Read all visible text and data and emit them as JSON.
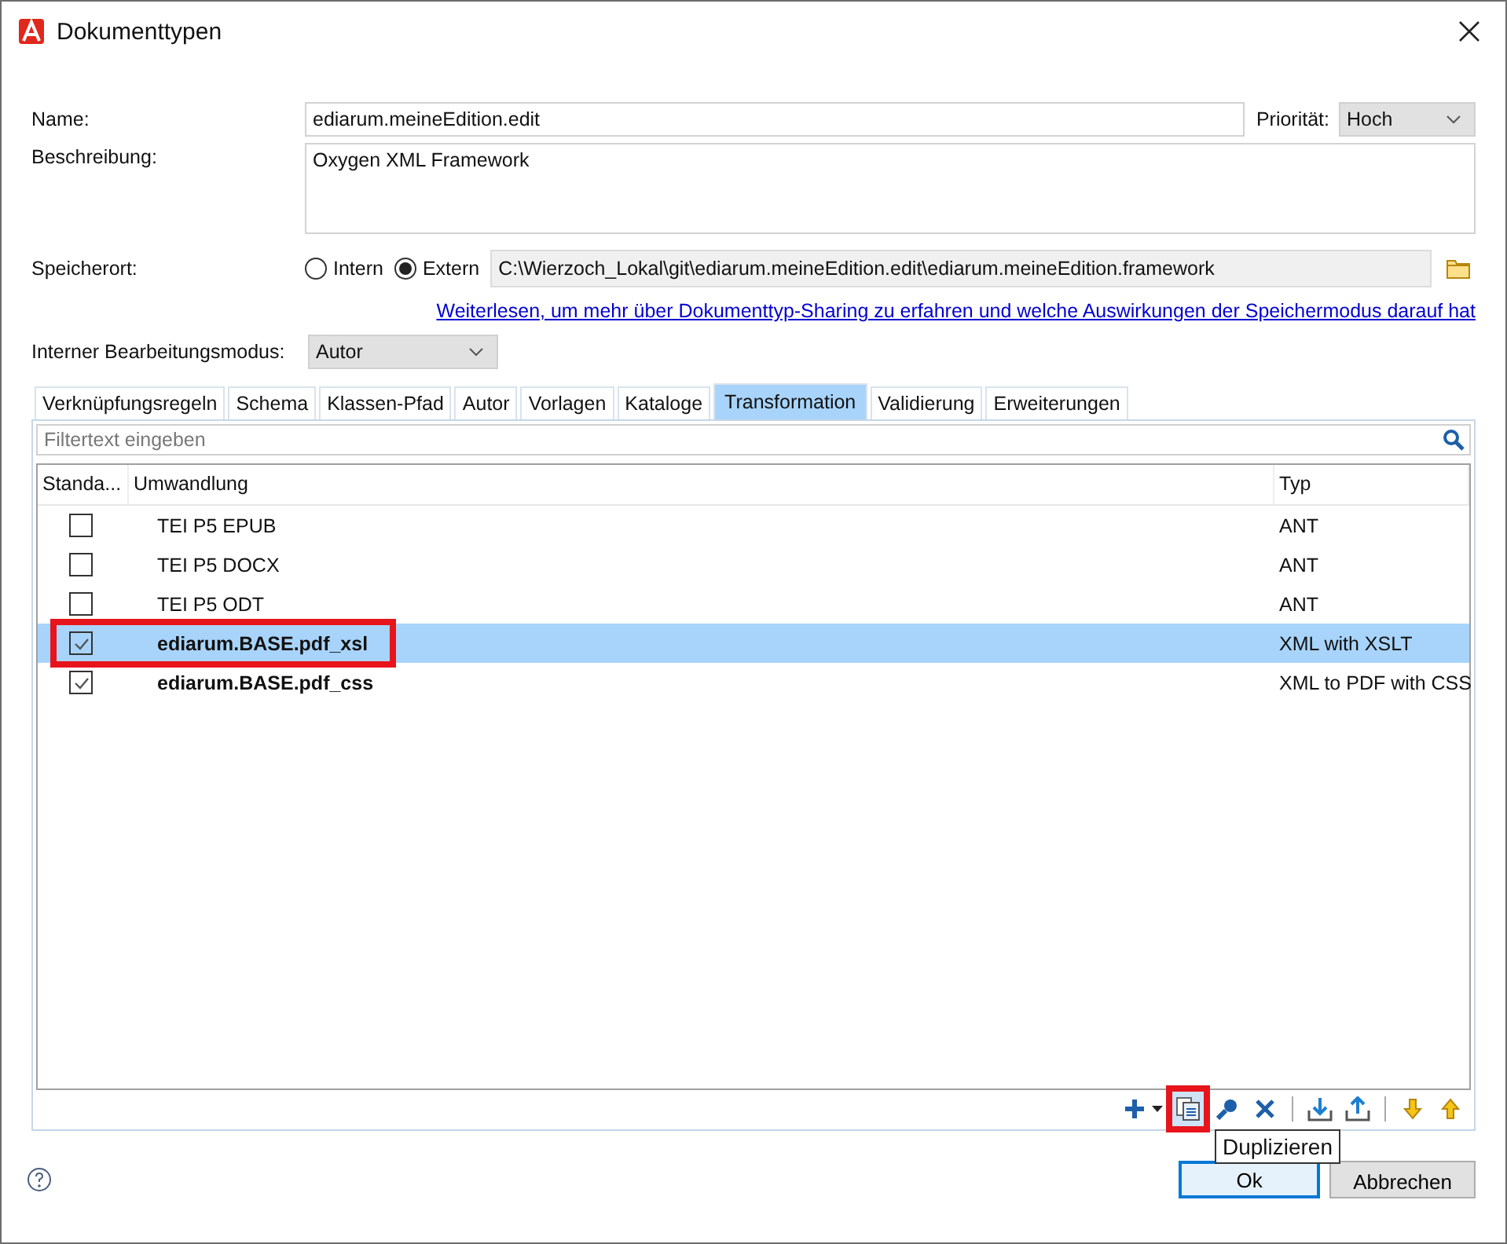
{
  "window": {
    "title": "Dokumenttypen"
  },
  "form": {
    "name_label": "Name:",
    "name_value": "ediarum.meineEdition.edit",
    "priority_label": "Priorität:",
    "priority_value": "Hoch",
    "description_label": "Beschreibung:",
    "description_value": "Oxygen XML Framework",
    "location_label": "Speicherort:",
    "location_options": [
      {
        "label": "Intern",
        "selected": false
      },
      {
        "label": "Extern",
        "selected": true
      }
    ],
    "location_path": "C:\\Wierzoch_Lokal\\git\\ediarum.meineEdition.edit\\ediarum.meineEdition.framework",
    "info_link": "Weiterlesen, um mehr über Dokumenttyp-Sharing zu erfahren und welche Auswirkungen der Speichermodus darauf hat",
    "mode_label": "Interner Bearbeitungsmodus:",
    "mode_value": "Autor"
  },
  "tabs": [
    {
      "label": "Verknüpfungsregeln",
      "selected": false
    },
    {
      "label": "Schema",
      "selected": false
    },
    {
      "label": "Klassen-Pfad",
      "selected": false
    },
    {
      "label": "Autor",
      "selected": false
    },
    {
      "label": "Vorlagen",
      "selected": false
    },
    {
      "label": "Kataloge",
      "selected": false
    },
    {
      "label": "Transformation",
      "selected": true
    },
    {
      "label": "Validierung",
      "selected": false
    },
    {
      "label": "Erweiterungen",
      "selected": false
    }
  ],
  "filter": {
    "placeholder": "Filtertext eingeben"
  },
  "table": {
    "columns": [
      "Standa...",
      "Umwandlung",
      "Typ"
    ],
    "rows": [
      {
        "name": "TEI P5 EPUB",
        "type": "ANT",
        "checked": false,
        "selected": false,
        "emphasized": false,
        "highlighted": false
      },
      {
        "name": "TEI P5 DOCX",
        "type": "ANT",
        "checked": false,
        "selected": false,
        "emphasized": false,
        "highlighted": false
      },
      {
        "name": "TEI P5 ODT",
        "type": "ANT",
        "checked": false,
        "selected": false,
        "emphasized": false,
        "highlighted": false
      },
      {
        "name": "ediarum.BASE.pdf_xsl",
        "type": "XML with XSLT",
        "checked": true,
        "selected": true,
        "emphasized": true,
        "highlighted": true
      },
      {
        "name": "ediarum.BASE.pdf_css",
        "type": "XML to PDF with CSS",
        "checked": true,
        "selected": false,
        "emphasized": true,
        "highlighted": false
      }
    ]
  },
  "toolbar": [
    {
      "kind": "add"
    },
    {
      "kind": "caret"
    },
    {
      "kind": "duplicate",
      "highlighted": true
    },
    {
      "kind": "edit"
    },
    {
      "kind": "delete"
    },
    {
      "kind": "separator"
    },
    {
      "kind": "import"
    },
    {
      "kind": "export"
    },
    {
      "kind": "separator"
    },
    {
      "kind": "down"
    },
    {
      "kind": "up"
    }
  ],
  "tooltip": {
    "text": "Duplizieren"
  },
  "buttons": [
    {
      "label": "Ok",
      "default": true
    },
    {
      "label": "Abbrechen",
      "default": false
    }
  ]
}
